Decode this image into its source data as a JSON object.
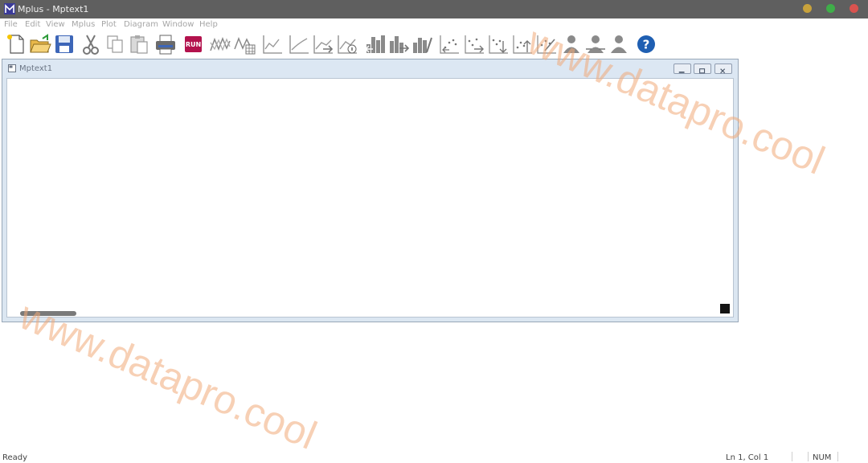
{
  "app": {
    "title": "Mplus - Mptext1",
    "traffic_colors": [
      "#c8a23c",
      "#3fae49",
      "#d9534f"
    ]
  },
  "menu": [
    "File",
    "Edit",
    "View",
    "Mplus",
    "Plot",
    "Diagram",
    "Window",
    "Help"
  ],
  "toolbar": {
    "run_label": "RUN",
    "help_glyph": "?",
    "icons": [
      "new-icon",
      "open-icon",
      "save-icon",
      "cut-icon",
      "copy-icon",
      "paste-icon",
      "print-icon",
      "run-icon",
      "plot-line-icon",
      "plot-grid-icon",
      "plot-a-icon",
      "plot-b-icon",
      "plot-c-icon",
      "plot-d-icon",
      "bar-a-icon",
      "bar-b-icon",
      "bar-c-icon",
      "scatter-a-icon",
      "scatter-b-icon",
      "scatter-c-icon",
      "scatter-d-icon",
      "scatter-e-icon",
      "person-a-icon",
      "person-b-icon",
      "person-c-icon",
      "help-icon"
    ]
  },
  "child_window": {
    "title": "Mptext1"
  },
  "status": {
    "ready": "Ready",
    "position": "Ln 1, Col 1",
    "num": "NUM"
  },
  "watermark": {
    "text": "www.datapro.cool",
    "color": "#f0aa78"
  }
}
